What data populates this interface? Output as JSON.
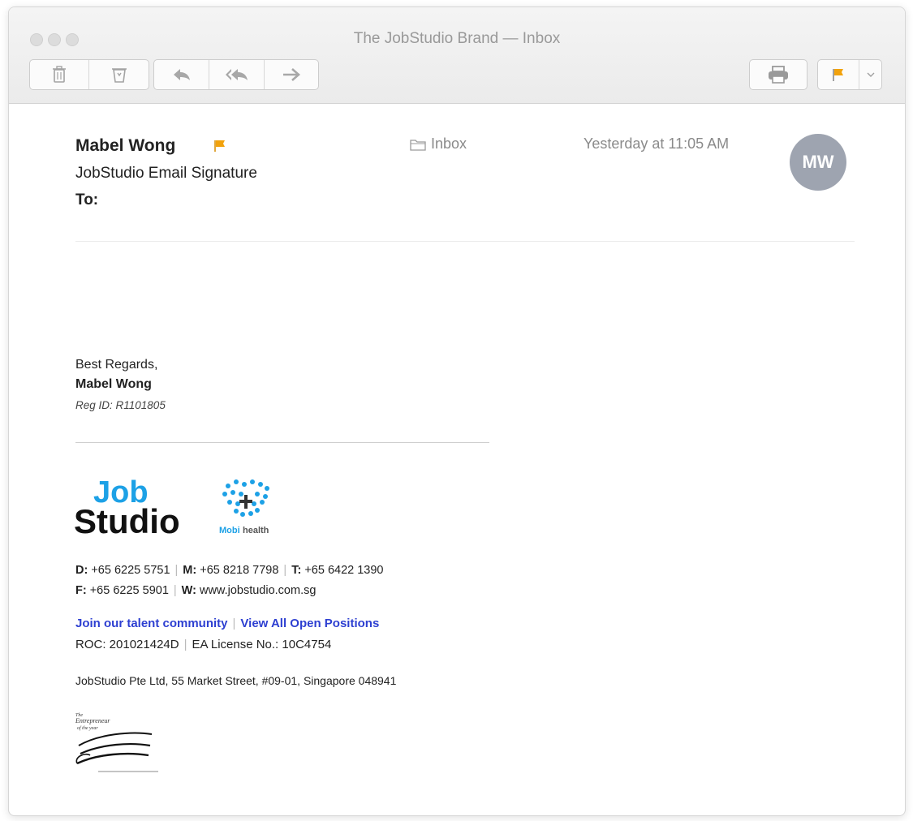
{
  "window": {
    "title": "The JobStudio Brand — Inbox"
  },
  "toolbar": {
    "delete_icon": "trash-icon",
    "junk_icon": "junk-icon",
    "reply_icon": "reply-icon",
    "reply_all_icon": "reply-all-icon",
    "forward_icon": "forward-icon",
    "print_icon": "printer-icon",
    "flag_icon": "flag-icon",
    "flag_color": "#f2a20c"
  },
  "message": {
    "sender": "Mabel Wong",
    "subject": "JobStudio Email Signature",
    "to_label": "To:",
    "mailbox": "Inbox",
    "date": "Yesterday at 11:05 AM",
    "avatar_initials": "MW",
    "avatar_color": "#9ea4b0"
  },
  "signature": {
    "greeting": "Best Regards,",
    "name": "Mabel Wong",
    "reg_id": "Reg ID: R1101805",
    "logo_job": "Job",
    "logo_studio": "Studio",
    "mobi_logo_text_a": "Mobi",
    "mobi_logo_text_b": "health",
    "d_label": "D:",
    "d_value": "+65 6225 5751",
    "m_label": "M:",
    "m_value": "+65 8218 7798",
    "t_label": "T:",
    "t_value": "+65 6422 1390",
    "f_label": "F:",
    "f_value": "+65 6225 5901",
    "w_label": "W:",
    "w_value": "www.jobstudio.com.sg",
    "link_talent": "Join our talent community",
    "link_positions": "View All Open Positions",
    "roc": "ROC: 201021424D",
    "license": "EA License No.: 10C4754",
    "address": "JobStudio Pte Ltd, 55 Market Street, #09-01, Singapore 048941",
    "award_line1": "The",
    "award_line2": "Entrepreneur",
    "award_line3": "of the year",
    "link_color": "#2d3fd1",
    "brand_blue": "#1da1e6"
  }
}
